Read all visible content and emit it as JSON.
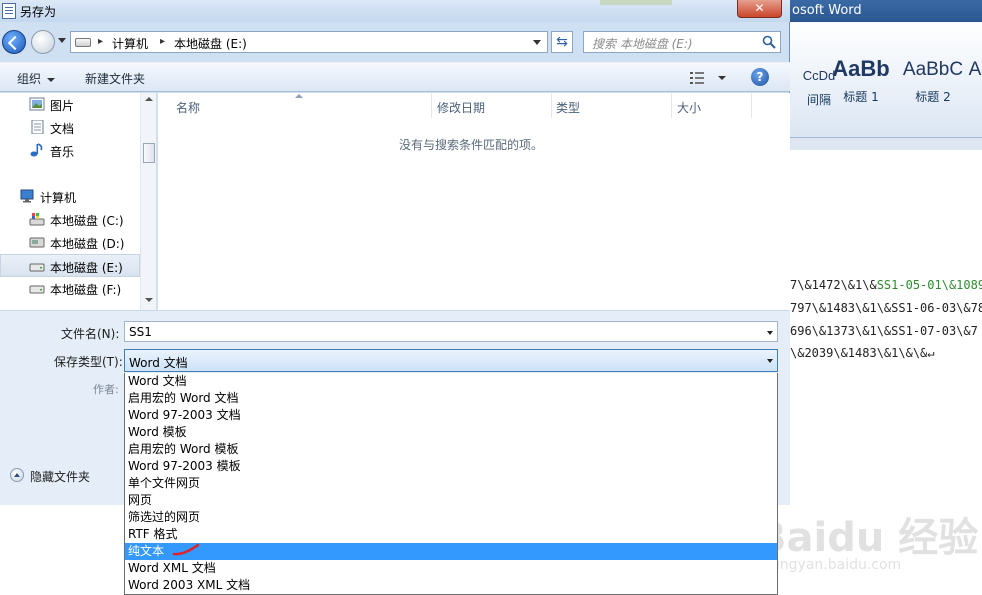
{
  "word": {
    "title_partial": "osoft Word",
    "styles": [
      {
        "sample": "CcDd",
        "name": "间隔"
      },
      {
        "sample": "AaBb",
        "name": "标题 1"
      },
      {
        "sample": "AaBbC",
        "name": "标题 2"
      },
      {
        "sample": "A",
        "name": ""
      }
    ],
    "doc_lines": [
      {
        "pre": "7\\&1472\\&1\\&",
        "green": "SS1-05-01\\&1089",
        "post": ""
      },
      {
        "pre": "797\\&1483\\&1\\&SS1-06-03\\&78",
        "green": "",
        "post": ""
      },
      {
        "pre": "696\\&1373\\&1\\&SS1-07-03\\&7",
        "green": "",
        "post": ""
      },
      {
        "pre": "\\&2039\\&1483\\&1\\&\\&↵",
        "green": "",
        "post": ""
      }
    ],
    "watermark": "Baidu 经验",
    "watermark_sub": "jingyan.baidu.com"
  },
  "dialog": {
    "title": "另存为",
    "close": "✕",
    "breadcrumb": [
      "计算机",
      "本地磁盘 (E:)"
    ],
    "search_placeholder": "搜索 本地磁盘 (E:)",
    "toolbar": {
      "organize": "组织",
      "new_folder": "新建文件夹"
    },
    "nav_items": [
      {
        "label": "图片",
        "icon": "pictures-icon"
      },
      {
        "label": "文档",
        "icon": "documents-icon"
      },
      {
        "label": "音乐",
        "icon": "music-icon"
      },
      {
        "label": "计算机",
        "icon": "computer-icon"
      },
      {
        "label": "本地磁盘 (C:)",
        "icon": "system-drive-icon"
      },
      {
        "label": "本地磁盘 (D:)",
        "icon": "drive-icon"
      },
      {
        "label": "本地磁盘 (E:)",
        "icon": "drive-icon",
        "selected": true
      },
      {
        "label": "本地磁盘 (F:)",
        "icon": "drive-icon"
      }
    ],
    "columns": [
      "名称",
      "修改日期",
      "类型",
      "大小"
    ],
    "empty_message": "没有与搜索条件匹配的项。",
    "filename_label": "文件名(N):",
    "filename_value": "SS1",
    "filetype_label": "保存类型(T):",
    "filetype_value": "Word 文档",
    "author_label": "作者:",
    "hide_folders": "隐藏文件夹",
    "filetype_options": [
      "Word 文档",
      "启用宏的 Word 文档",
      "Word 97-2003 文档",
      "Word 模板",
      "启用宏的 Word 模板",
      "Word 97-2003 模板",
      "单个文件网页",
      "网页",
      "筛选过的网页",
      "RTF 格式",
      "纯文本",
      "Word XML 文档",
      "Word 2003 XML 文档"
    ],
    "selected_option_index": 10,
    "colors": {
      "selection": "#3399ff",
      "annotation": "#e0202a"
    }
  }
}
